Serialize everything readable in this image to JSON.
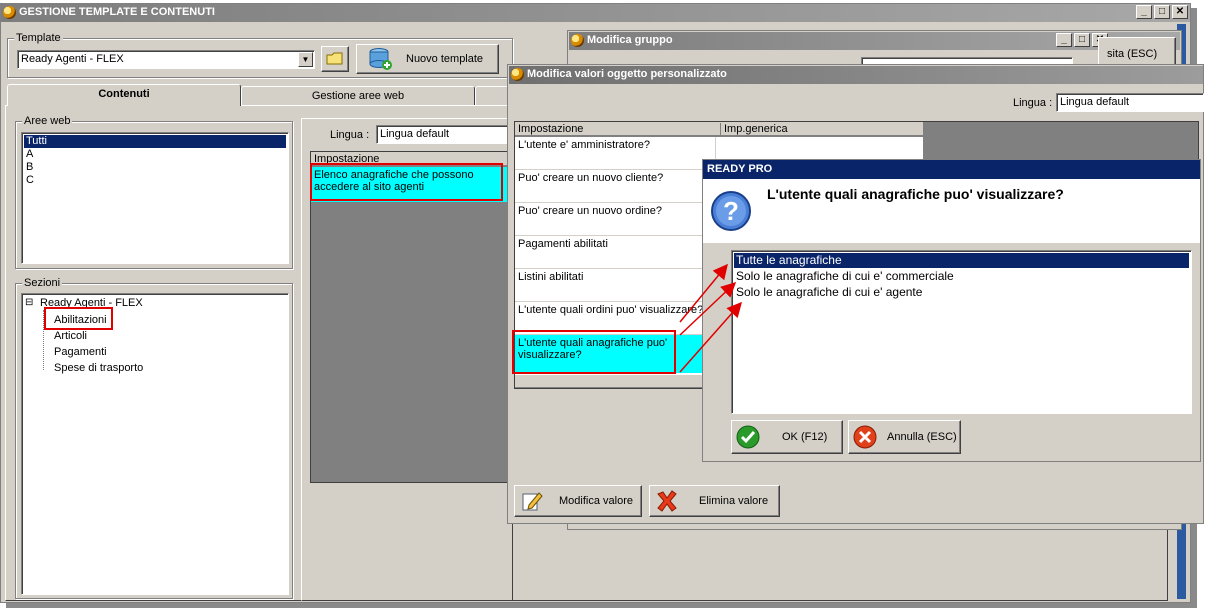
{
  "main_window": {
    "title": "GESTIONE TEMPLATE E CONTENUTI",
    "template_label": "Template",
    "template_value": "Ready Agenti - FLEX",
    "new_template_button": "Nuovo template",
    "tabs": [
      {
        "label": "Contenuti"
      },
      {
        "label": "Gestione aree web"
      }
    ],
    "aree_web_label": "Aree web",
    "aree_web_items": [
      "Tutti",
      "A",
      "B",
      "C"
    ],
    "sezioni_label": "Sezioni",
    "tree_root": "Ready Agenti - FLEX",
    "tree_children": [
      "Abilitazioni",
      "Articoli",
      "Pagamenti",
      "Spese di trasporto"
    ],
    "lingua_label": "Lingua :",
    "lingua_value": "Lingua default",
    "grid_header": "Impostazione",
    "grid_row": "Elenco anagrafiche che possono accedere al sito agenti"
  },
  "modifica_gruppo": {
    "title": "Modifica gruppo",
    "right_button_partial": "sita (ESC)"
  },
  "modifica_valori": {
    "title": "Modifica valori oggetto personalizzato",
    "lingua_label": "Lingua :",
    "lingua_value": "Lingua default",
    "col_impostazione": "Impostazione",
    "col_imp_generica": "Imp.generica",
    "rows": [
      "L'utente e' amministratore?",
      "Puo' creare un nuovo cliente?",
      "Puo' creare un nuovo ordine?",
      "Pagamenti abilitati",
      "Listini abilitati",
      "L'utente quali ordini puo' visualizzare?",
      "L'utente quali anagrafiche puo' visualizzare?"
    ],
    "modifica_button": "Modifica valore",
    "elimina_button": "Elimina valore"
  },
  "dialog": {
    "title": "READY PRO",
    "question": "L'utente quali anagrafiche puo' visualizzare?",
    "options": [
      "Tutte le anagrafiche",
      "Solo le anagrafiche di cui e' commerciale",
      "Solo le anagrafiche di cui e' agente"
    ],
    "selected_index": 0,
    "ok_button": "OK (F12)",
    "cancel_button": "Annulla (ESC)"
  },
  "colors": {
    "highlight_red": "#e00000",
    "selection_blue": "#0a246a",
    "cyan_cell": "#00ffff",
    "window_face": "#d4d0c8"
  }
}
